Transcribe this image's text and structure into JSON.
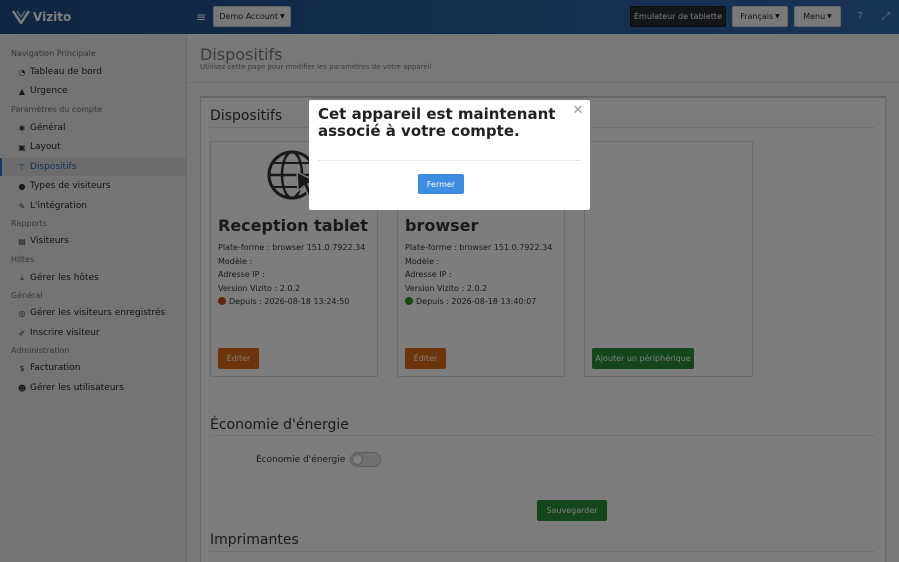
{
  "brand": {
    "name": "Vizito"
  },
  "topbar": {
    "account_label": "Demo Account",
    "tablet_emulator_label": "Émulateur de tablette",
    "language_label": "Français",
    "menu_label": "Menu",
    "help_icon": "question-icon",
    "expand_icon": "expand-icon"
  },
  "sidebar": {
    "sections": [
      {
        "label": "Navigation Principale"
      },
      {
        "label": "Paramètres du compte"
      },
      {
        "label": "Rapports"
      },
      {
        "label": "Hôtes"
      },
      {
        "label": "Général"
      },
      {
        "label": "Administration"
      }
    ],
    "items": [
      {
        "label": "Tableau de bord",
        "icon": "dashboard-icon"
      },
      {
        "label": "Urgence",
        "icon": "warning-icon"
      },
      {
        "label": "Général",
        "icon": "gear-icon"
      },
      {
        "label": "Layout",
        "icon": "image-icon"
      },
      {
        "label": "Dispositifs",
        "icon": "sitemap-icon",
        "active": true
      },
      {
        "label": "Types de visiteurs",
        "icon": "users-icon"
      },
      {
        "label": "L'intégration",
        "icon": "plug-icon"
      },
      {
        "label": "Visiteurs",
        "icon": "book-icon"
      },
      {
        "label": "Gérer les hôtes",
        "icon": "download-icon"
      },
      {
        "label": "Gérer les visiteurs enregistrés",
        "icon": "badge-icon"
      },
      {
        "label": "Inscrire visiteur",
        "icon": "pen-icon"
      },
      {
        "label": "Facturation",
        "icon": "dollar-icon"
      },
      {
        "label": "Gérer les utilisateurs",
        "icon": "user-plus-icon"
      }
    ]
  },
  "page": {
    "title": "Dispositifs",
    "subtitle": "Utilisez cette page pour modifier les paramètres de votre appareil"
  },
  "devices_section": {
    "heading": "Dispositifs",
    "devices": [
      {
        "name": "Reception tablet",
        "platform": "Plate-forme : browser 151.0.7922.34",
        "model": "Modèle :",
        "ip": "Adresse IP :",
        "version": "Version Vizito : 2.0.2",
        "since": "Depuis : 2026-08-18 13:24:50",
        "status_color": "#c8461c",
        "edit_label": "Éditer"
      },
      {
        "name": "browser",
        "platform": "Plate-forme : browser 151.0.7922.34",
        "model": "Modèle :",
        "ip": "Adresse IP :",
        "version": "Version Vizito : 2.0.2",
        "since": "Depuis : 2026-08-18 13:40:07",
        "status_color": "#3d8a1e",
        "edit_label": "Éditer"
      }
    ],
    "add_label": "Ajouter un périphérique"
  },
  "energy_section": {
    "heading": "Économie d'énergie",
    "toggle_label": "Économie d'énergie",
    "toggle_on": false,
    "save_label": "Sauvegarder"
  },
  "printers_section": {
    "heading": "Imprimantes"
  },
  "modal": {
    "title": "Cet appareil est maintenant associé à votre compte.",
    "close_label": "Fermer"
  },
  "colors": {
    "accent": "#2f67ad",
    "edit_button": "#d86a17",
    "success_button": "#2a8b37",
    "modal_button": "#3e8de0"
  }
}
